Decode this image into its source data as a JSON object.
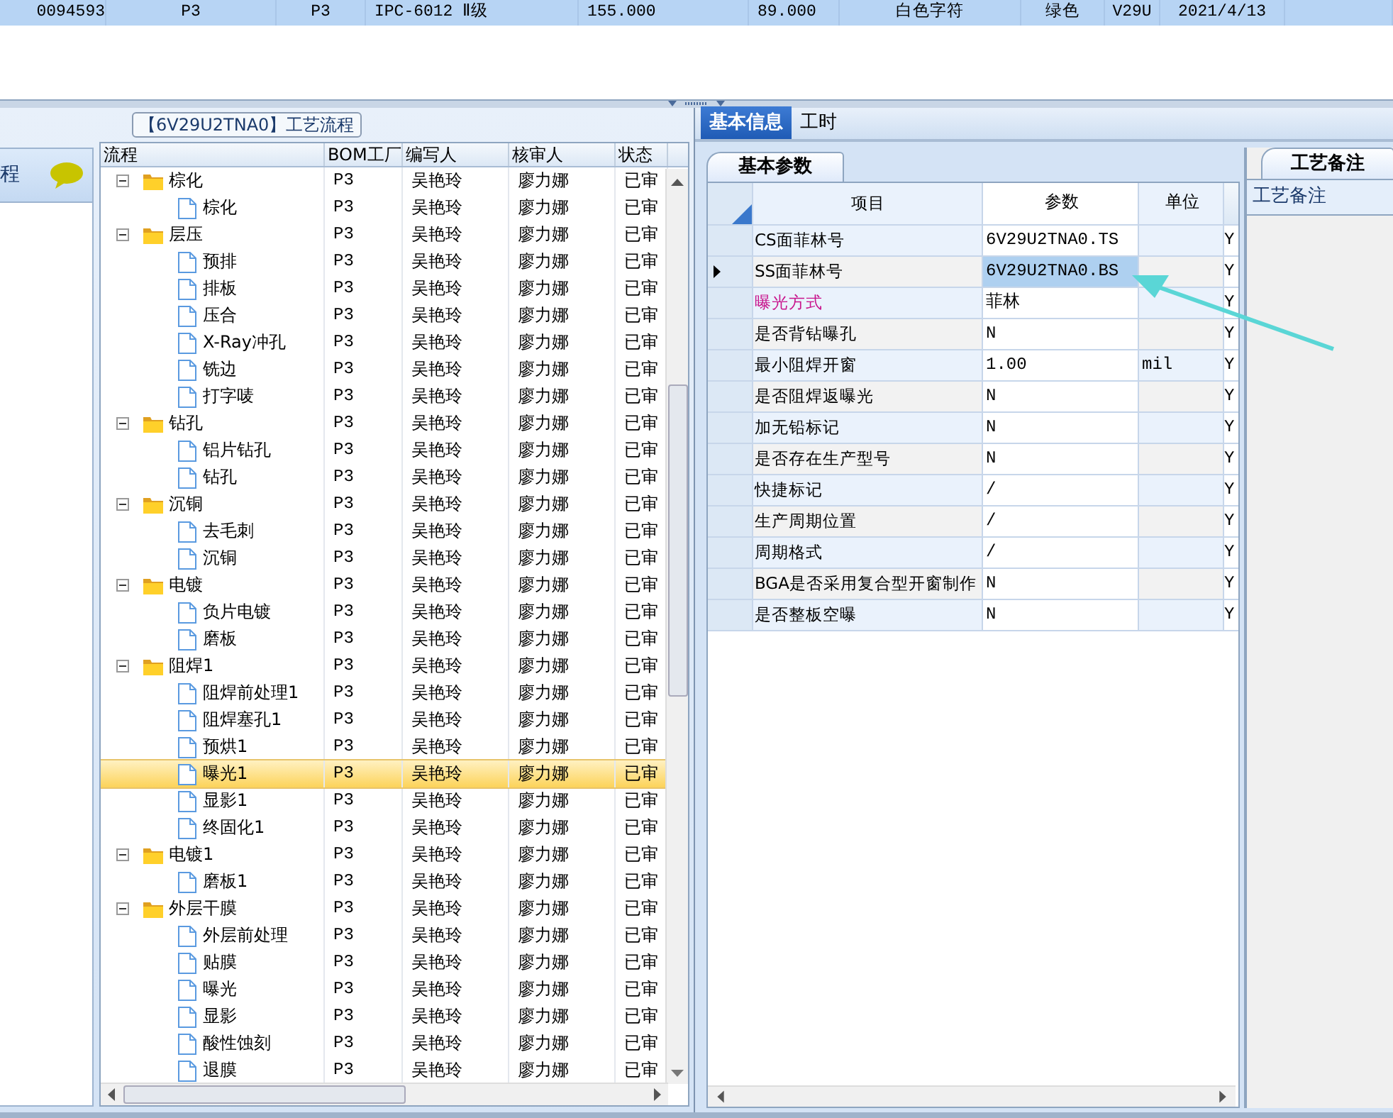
{
  "top_row": [
    "0094593",
    "P3",
    "P3",
    "IPC-6012 Ⅱ级",
    "155.000",
    "89.000",
    "白色字符",
    "绿色",
    "V29U",
    "2021/4/13"
  ],
  "side_panel": {
    "title": "程"
  },
  "process_group": {
    "title": "【6V29U2TNA0】工艺流程"
  },
  "process_grid": {
    "columns": [
      "流程",
      "BOM工厂",
      "编写人",
      "核审人",
      "状态"
    ],
    "rows": [
      {
        "name": "棕化",
        "factory": "P3",
        "writer": "吴艳玲",
        "reviewer": "廖力娜",
        "status": "已审",
        "expanded": true,
        "selected": false,
        "children": [
          {
            "name": "棕化",
            "factory": "P3",
            "writer": "吴艳玲",
            "reviewer": "廖力娜",
            "status": "已审",
            "selected": false
          }
        ]
      },
      {
        "name": "层压",
        "factory": "P3",
        "writer": "吴艳玲",
        "reviewer": "廖力娜",
        "status": "已审",
        "expanded": true,
        "selected": false,
        "children": [
          {
            "name": "预排",
            "factory": "P3",
            "writer": "吴艳玲",
            "reviewer": "廖力娜",
            "status": "已审",
            "selected": false
          },
          {
            "name": "排板",
            "factory": "P3",
            "writer": "吴艳玲",
            "reviewer": "廖力娜",
            "status": "已审",
            "selected": false
          },
          {
            "name": "压合",
            "factory": "P3",
            "writer": "吴艳玲",
            "reviewer": "廖力娜",
            "status": "已审",
            "selected": false
          },
          {
            "name": "X-Ray冲孔",
            "factory": "P3",
            "writer": "吴艳玲",
            "reviewer": "廖力娜",
            "status": "已审",
            "selected": false
          },
          {
            "name": "铣边",
            "factory": "P3",
            "writer": "吴艳玲",
            "reviewer": "廖力娜",
            "status": "已审",
            "selected": false
          },
          {
            "name": "打字唛",
            "factory": "P3",
            "writer": "吴艳玲",
            "reviewer": "廖力娜",
            "status": "已审",
            "selected": false
          }
        ]
      },
      {
        "name": "钻孔",
        "factory": "P3",
        "writer": "吴艳玲",
        "reviewer": "廖力娜",
        "status": "已审",
        "expanded": true,
        "selected": false,
        "children": [
          {
            "name": "铝片钻孔",
            "factory": "P3",
            "writer": "吴艳玲",
            "reviewer": "廖力娜",
            "status": "已审",
            "selected": false
          },
          {
            "name": "钻孔",
            "factory": "P3",
            "writer": "吴艳玲",
            "reviewer": "廖力娜",
            "status": "已审",
            "selected": false
          }
        ]
      },
      {
        "name": "沉铜",
        "factory": "P3",
        "writer": "吴艳玲",
        "reviewer": "廖力娜",
        "status": "已审",
        "expanded": true,
        "selected": false,
        "children": [
          {
            "name": "去毛刺",
            "factory": "P3",
            "writer": "吴艳玲",
            "reviewer": "廖力娜",
            "status": "已审",
            "selected": false
          },
          {
            "name": "沉铜",
            "factory": "P3",
            "writer": "吴艳玲",
            "reviewer": "廖力娜",
            "status": "已审",
            "selected": false
          }
        ]
      },
      {
        "name": "电镀",
        "factory": "P3",
        "writer": "吴艳玲",
        "reviewer": "廖力娜",
        "status": "已审",
        "expanded": true,
        "selected": false,
        "children": [
          {
            "name": "负片电镀",
            "factory": "P3",
            "writer": "吴艳玲",
            "reviewer": "廖力娜",
            "status": "已审",
            "selected": false
          },
          {
            "name": "磨板",
            "factory": "P3",
            "writer": "吴艳玲",
            "reviewer": "廖力娜",
            "status": "已审",
            "selected": false
          }
        ]
      },
      {
        "name": "阻焊1",
        "factory": "P3",
        "writer": "吴艳玲",
        "reviewer": "廖力娜",
        "status": "已审",
        "expanded": true,
        "selected": false,
        "children": [
          {
            "name": "阻焊前处理1",
            "factory": "P3",
            "writer": "吴艳玲",
            "reviewer": "廖力娜",
            "status": "已审",
            "selected": false
          },
          {
            "name": "阻焊塞孔1",
            "factory": "P3",
            "writer": "吴艳玲",
            "reviewer": "廖力娜",
            "status": "已审",
            "selected": false
          },
          {
            "name": "预烘1",
            "factory": "P3",
            "writer": "吴艳玲",
            "reviewer": "廖力娜",
            "status": "已审",
            "selected": false
          },
          {
            "name": "曝光1",
            "factory": "P3",
            "writer": "吴艳玲",
            "reviewer": "廖力娜",
            "status": "已审",
            "selected": true
          },
          {
            "name": "显影1",
            "factory": "P3",
            "writer": "吴艳玲",
            "reviewer": "廖力娜",
            "status": "已审",
            "selected": false
          },
          {
            "name": "终固化1",
            "factory": "P3",
            "writer": "吴艳玲",
            "reviewer": "廖力娜",
            "status": "已审",
            "selected": false
          }
        ]
      },
      {
        "name": "电镀1",
        "factory": "P3",
        "writer": "吴艳玲",
        "reviewer": "廖力娜",
        "status": "已审",
        "expanded": true,
        "selected": false,
        "children": [
          {
            "name": "磨板1",
            "factory": "P3",
            "writer": "吴艳玲",
            "reviewer": "廖力娜",
            "status": "已审",
            "selected": false
          }
        ]
      },
      {
        "name": "外层干膜",
        "factory": "P3",
        "writer": "吴艳玲",
        "reviewer": "廖力娜",
        "status": "已审",
        "expanded": true,
        "selected": false,
        "children": [
          {
            "name": "外层前处理",
            "factory": "P3",
            "writer": "吴艳玲",
            "reviewer": "廖力娜",
            "status": "已审",
            "selected": false
          },
          {
            "name": "贴膜",
            "factory": "P3",
            "writer": "吴艳玲",
            "reviewer": "廖力娜",
            "status": "已审",
            "selected": false
          },
          {
            "name": "曝光",
            "factory": "P3",
            "writer": "吴艳玲",
            "reviewer": "廖力娜",
            "status": "已审",
            "selected": false
          },
          {
            "name": "显影",
            "factory": "P3",
            "writer": "吴艳玲",
            "reviewer": "廖力娜",
            "status": "已审",
            "selected": false
          },
          {
            "name": "酸性蚀刻",
            "factory": "P3",
            "writer": "吴艳玲",
            "reviewer": "廖力娜",
            "status": "已审",
            "selected": false
          },
          {
            "name": "退膜",
            "factory": "P3",
            "writer": "吴艳玲",
            "reviewer": "廖力娜",
            "status": "已审",
            "selected": false
          }
        ]
      }
    ]
  },
  "tabs": [
    {
      "label": "基本信息",
      "selected": true
    },
    {
      "label": "工时",
      "selected": false
    }
  ],
  "param_tab": {
    "label": "基本参数"
  },
  "param_grid": {
    "columns": [
      "项目",
      "参数",
      "单位"
    ],
    "rows": [
      {
        "item": "CS面菲林号",
        "value": "6V29U2TNA0.TS",
        "unit": "",
        "column_4": "Y",
        "selected": false,
        "emphasis": false
      },
      {
        "item": "SS面菲林号",
        "value": "6V29U2TNA0.BS",
        "unit": "",
        "column_4": "Y",
        "selected": true,
        "emphasis": false
      },
      {
        "item": "曝光方式",
        "value": "菲林",
        "unit": "",
        "column_4": "Y",
        "selected": false,
        "emphasis": true
      },
      {
        "item": "是否背钻曝孔",
        "value": "N",
        "unit": "",
        "column_4": "Y",
        "selected": false,
        "emphasis": false
      },
      {
        "item": "最小阻焊开窗",
        "value": "1.00",
        "unit": "mil",
        "column_4": "Y",
        "selected": false,
        "emphasis": false
      },
      {
        "item": "是否阻焊返曝光",
        "value": "N",
        "unit": "",
        "column_4": "Y",
        "selected": false,
        "emphasis": false
      },
      {
        "item": "加无铅标记",
        "value": "N",
        "unit": "",
        "column_4": "Y",
        "selected": false,
        "emphasis": false
      },
      {
        "item": "是否存在生产型号",
        "value": "N",
        "unit": "",
        "column_4": "Y",
        "selected": false,
        "emphasis": false
      },
      {
        "item": "快捷标记",
        "value": "/",
        "unit": "",
        "column_4": "Y",
        "selected": false,
        "emphasis": false
      },
      {
        "item": "生产周期位置",
        "value": "/",
        "unit": "",
        "column_4": "Y",
        "selected": false,
        "emphasis": false
      },
      {
        "item": "周期格式",
        "value": "/",
        "unit": "",
        "column_4": "Y",
        "selected": false,
        "emphasis": false
      },
      {
        "item": "BGA是否采用复合型开窗制作",
        "value": "N",
        "unit": "",
        "column_4": "Y",
        "selected": false,
        "emphasis": false
      },
      {
        "item": "是否整板空曝",
        "value": "N",
        "unit": "",
        "column_4": "Y",
        "selected": false,
        "emphasis": false
      }
    ]
  },
  "notes_panel": {
    "tab": "工艺备注",
    "label": "工艺备注"
  }
}
